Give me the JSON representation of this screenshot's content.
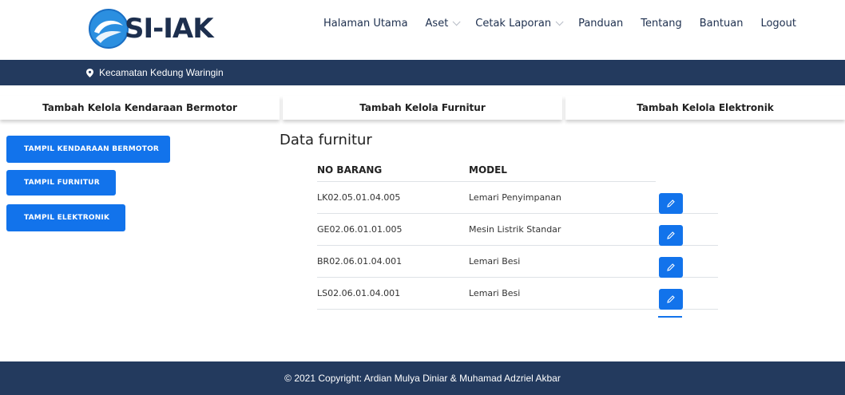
{
  "brand": {
    "name": "SI-IAK"
  },
  "nav": [
    {
      "label": "Halaman Utama",
      "dropdown": false
    },
    {
      "label": "Aset",
      "dropdown": true
    },
    {
      "label": "Cetak Laporan",
      "dropdown": true
    },
    {
      "label": "Panduan",
      "dropdown": false
    },
    {
      "label": "Tentang",
      "dropdown": false
    },
    {
      "label": "Bantuan",
      "dropdown": false
    },
    {
      "label": "Logout",
      "dropdown": false
    }
  ],
  "location": {
    "text": "Kecamatan Kedung Waringin",
    "icon": "map-pin-icon"
  },
  "tabs": [
    {
      "label": "Tambah Kelola Kendaraan Bermotor"
    },
    {
      "label": "Tambah Kelola Furnitur"
    },
    {
      "label": "Tambah Kelola Elektronik"
    }
  ],
  "sidebar": [
    {
      "label": "TAMPIL KENDARAAN BERMOTOR"
    },
    {
      "label": "TAMPIL FURNITUR"
    },
    {
      "label": "TAMPIL ELEKTRONIK"
    }
  ],
  "main": {
    "title": "Data furnitur",
    "columns": [
      "NO BARANG",
      "MODEL"
    ],
    "rows": [
      {
        "no_barang": "LK02.05.01.04.005",
        "model": "Lemari Penyimpanan"
      },
      {
        "no_barang": "GE02.06.01.01.005",
        "model": "Mesin Listrik Standar"
      },
      {
        "no_barang": "BR02.06.01.04.001",
        "model": "Lemari Besi"
      },
      {
        "no_barang": "LS02.06.01.04.001",
        "model": "Lemari Besi"
      }
    ]
  },
  "footer": {
    "text": "© 2021 Copyright: Ardian Mulya Diniar & Muhamad Adzriel Akbar"
  },
  "colors": {
    "primary": "#1273eb",
    "navy": "#233a5e",
    "brand_text": "#1d2f4e"
  }
}
